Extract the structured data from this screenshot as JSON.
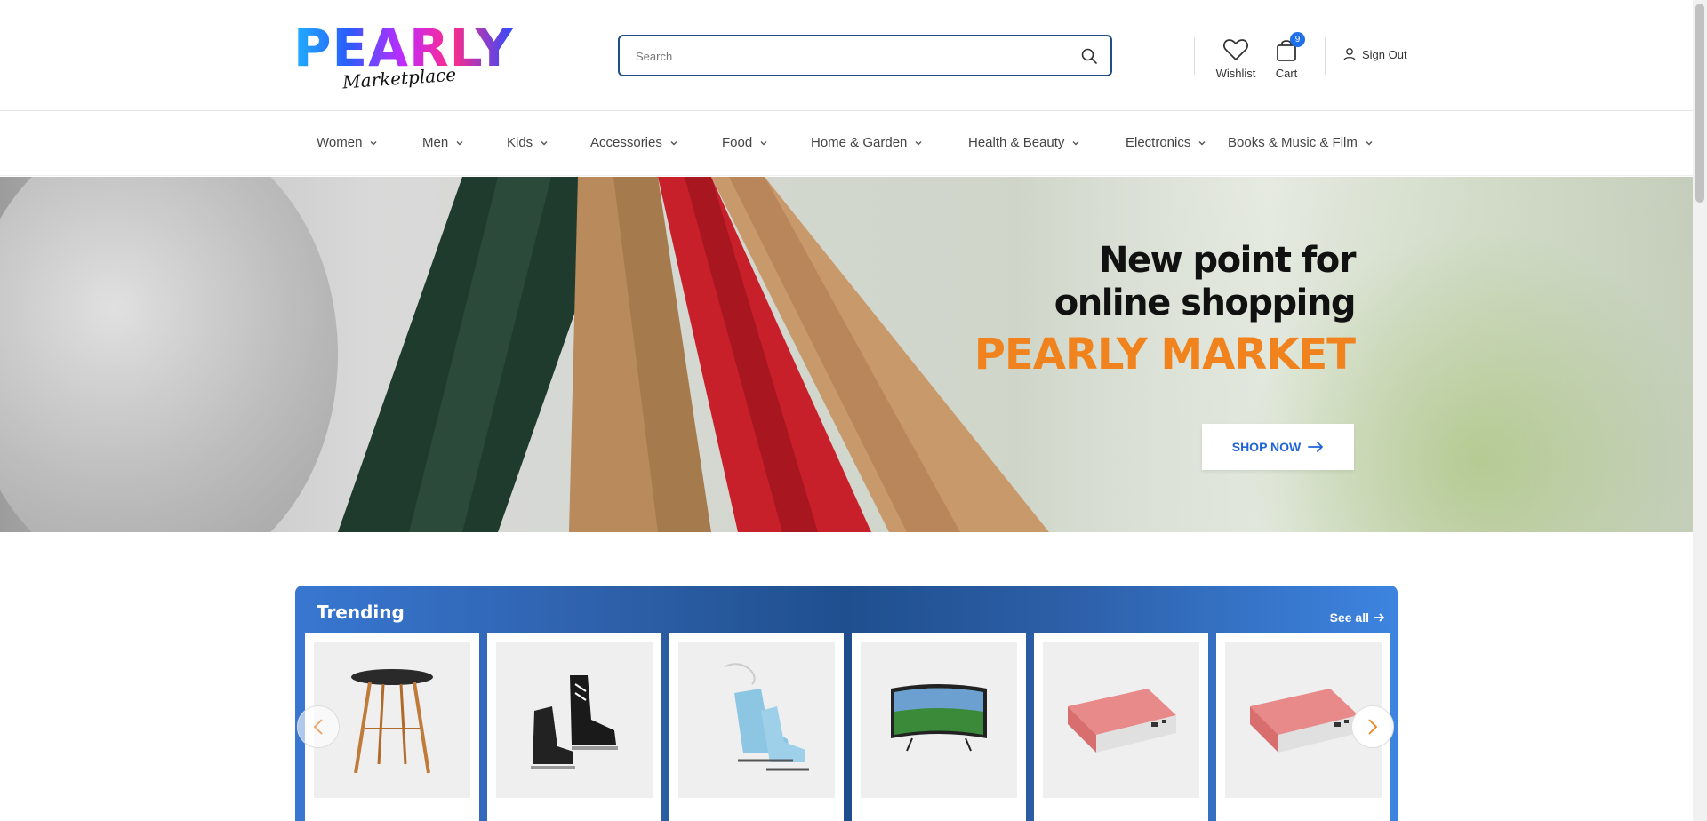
{
  "header": {
    "logo_main": "PEARLY",
    "logo_sub": "Marketplace",
    "search_placeholder": "Search",
    "wishlist_label": "Wishlist",
    "cart_label": "Cart",
    "cart_count": "9",
    "signout_label": "Sign Out"
  },
  "nav": {
    "items": [
      {
        "label": "Women"
      },
      {
        "label": "Men"
      },
      {
        "label": "Kids"
      },
      {
        "label": "Accessories"
      },
      {
        "label": "Food"
      },
      {
        "label": "Home & Garden"
      },
      {
        "label": "Health & Beauty"
      },
      {
        "label": "Electronics"
      },
      {
        "label": "Books & Music & Film"
      }
    ]
  },
  "hero": {
    "title_line1": "New point for",
    "title_line2": "online shopping",
    "brand": "PEARLY MARKET",
    "cta_label": "SHOP NOW"
  },
  "trending": {
    "title": "Trending",
    "see_all_label": "See all",
    "products": [
      {
        "icon": "side-table-icon"
      },
      {
        "icon": "hockey-skates-icon"
      },
      {
        "icon": "ice-skates-icon"
      },
      {
        "icon": "curved-tv-icon"
      },
      {
        "icon": "power-bank-icon"
      },
      {
        "icon": "power-bank-icon"
      }
    ]
  },
  "colors": {
    "accent_blue": "#1f63d6",
    "brand_orange": "#f0831d",
    "search_border": "#1f4f86",
    "badge_blue": "#1e6fe8"
  }
}
